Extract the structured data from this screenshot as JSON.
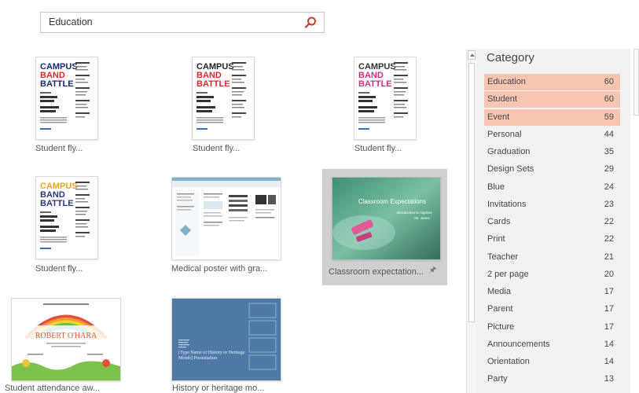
{
  "search": {
    "value": "Education"
  },
  "templates": [
    {
      "caption": "Student fly...",
      "flyer": {
        "l1": "CAMPUS",
        "l2": "BAND",
        "l3": "BATTLE",
        "colors": [
          "#1a2a6c",
          "#d42d2d",
          "#1a2a6c"
        ]
      }
    },
    {
      "caption": "Student fly...",
      "flyer": {
        "l1": "CAMPUS",
        "l2": "BAND",
        "l3": "BATTLE",
        "colors": [
          "#222222",
          "#d42d2d",
          "#d42d2d"
        ]
      }
    },
    {
      "caption": "Student fly...",
      "flyer": {
        "l1": "CAMPUS",
        "l2": "BAND",
        "l3": "BATTLE",
        "colors": [
          "#333333",
          "#c8327a",
          "#c8327a"
        ]
      }
    },
    {
      "caption": "Student fly...",
      "flyer": {
        "l1": "CAMPUS",
        "l2": "BAND",
        "l3": "BATTLE",
        "colors": [
          "#e7a41b",
          "#2a3a7a",
          "#2a3a7a"
        ]
      }
    },
    {
      "caption": "Medical poster with gra..."
    },
    {
      "caption": "Classroom expectation...",
      "slide_title": "Classroom Expectations",
      "slide_sub1": "Introduction to Algebra",
      "slide_sub2": "Mr. Jones"
    },
    {
      "caption": "Student attendance aw...",
      "cert_name": "ROBERT O'HARA"
    },
    {
      "caption": "History or heritage mo...",
      "slide_text": "[Type Name of History or Heritage Month] Presentation"
    }
  ],
  "category": {
    "title": "Category",
    "items": [
      {
        "name": "Education",
        "count": "60",
        "highlighted": true
      },
      {
        "name": "Student",
        "count": "60",
        "highlighted": true
      },
      {
        "name": "Event",
        "count": "59",
        "highlighted": true
      },
      {
        "name": "Personal",
        "count": "44"
      },
      {
        "name": "Graduation",
        "count": "35"
      },
      {
        "name": "Design Sets",
        "count": "29"
      },
      {
        "name": "Blue",
        "count": "24"
      },
      {
        "name": "Invitations",
        "count": "23"
      },
      {
        "name": "Cards",
        "count": "22"
      },
      {
        "name": "Print",
        "count": "22"
      },
      {
        "name": "Teacher",
        "count": "21"
      },
      {
        "name": "2 per page",
        "count": "20"
      },
      {
        "name": "Media",
        "count": "17"
      },
      {
        "name": "Parent",
        "count": "17"
      },
      {
        "name": "Picture",
        "count": "17"
      },
      {
        "name": "Announcements",
        "count": "14"
      },
      {
        "name": "Orientation",
        "count": "14"
      },
      {
        "name": "Party",
        "count": "13"
      }
    ]
  },
  "colors": {
    "highlight": "#f7c5b2",
    "accent": "#c5402b",
    "selected": "#d0d0d0"
  }
}
